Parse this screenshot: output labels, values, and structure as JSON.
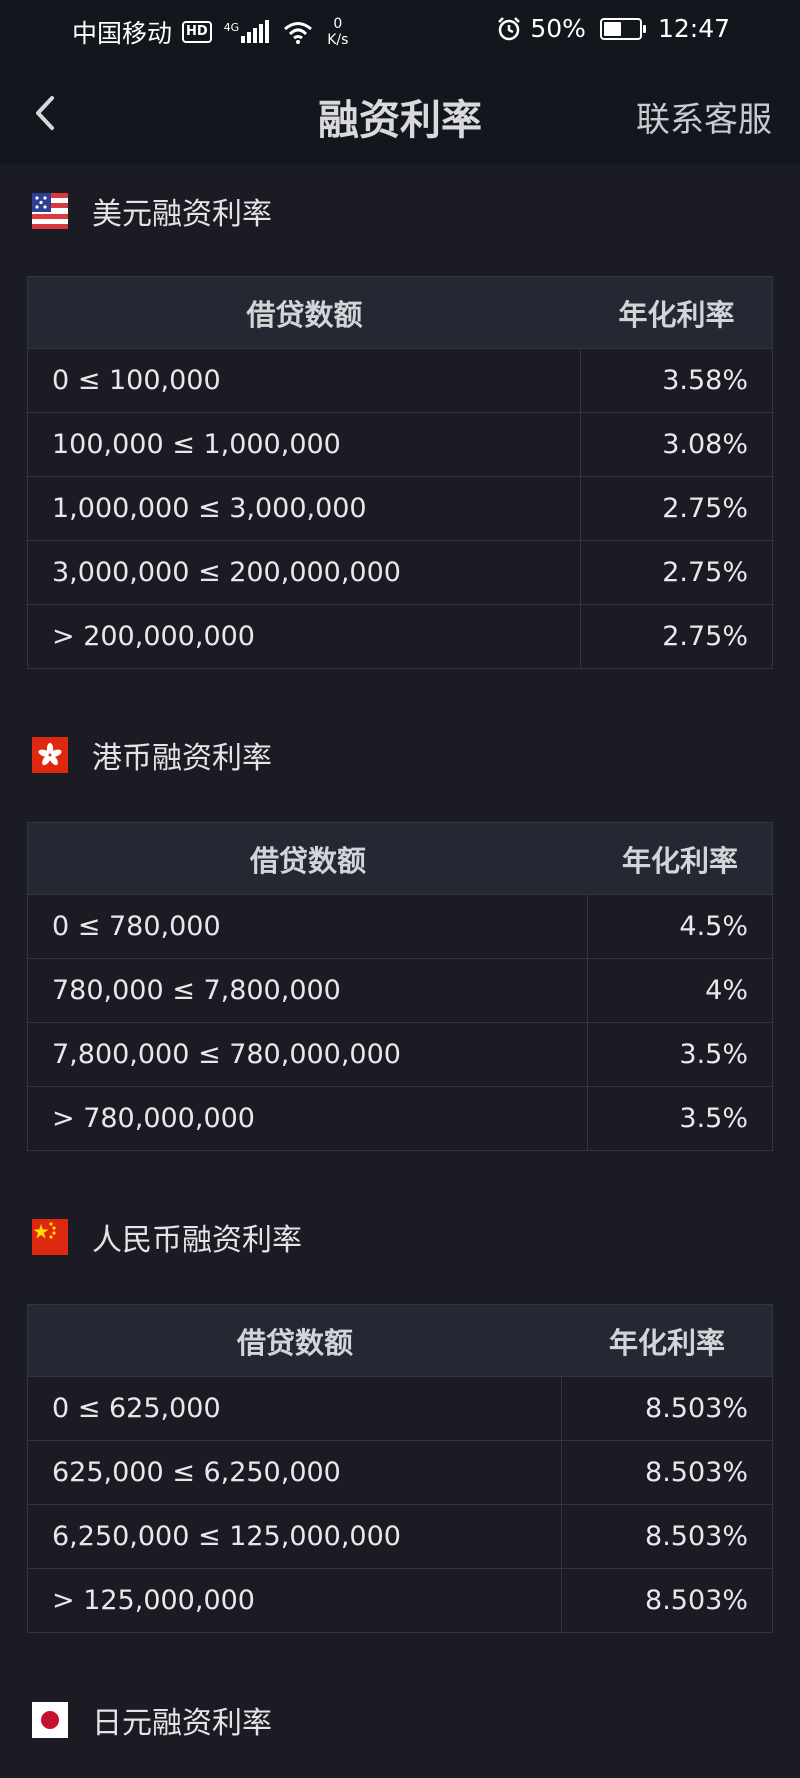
{
  "status_bar": {
    "carrier": "中国移动",
    "hd": "HD",
    "network": "4G",
    "speed_value": "0",
    "speed_unit": "K/s",
    "battery": "50%",
    "battery_level": 0.5,
    "time": "12:47"
  },
  "header": {
    "title": "融资利率",
    "action": "联系客服"
  },
  "sections": [
    {
      "title": "美元融资利率",
      "flag_icon": "us-flag-icon",
      "columns": [
        "借贷数额",
        "年化利率"
      ],
      "rows": [
        {
          "amount": "0 ≤ 100,000",
          "rate": "3.58%"
        },
        {
          "amount": "100,000 ≤ 1,000,000",
          "rate": "3.08%"
        },
        {
          "amount": "1,000,000 ≤ 3,000,000",
          "rate": "2.75%"
        },
        {
          "amount": "3,000,000 ≤ 200,000,000",
          "rate": "2.75%"
        },
        {
          "amount": "> 200,000,000",
          "rate": "2.75%"
        }
      ]
    },
    {
      "title": "港币融资利率",
      "flag_icon": "hk-flag-icon",
      "columns": [
        "借贷数额",
        "年化利率"
      ],
      "rows": [
        {
          "amount": "0 ≤ 780,000",
          "rate": "4.5%"
        },
        {
          "amount": "780,000 ≤ 7,800,000",
          "rate": "4%"
        },
        {
          "amount": "7,800,000 ≤ 780,000,000",
          "rate": "3.5%"
        },
        {
          "amount": "> 780,000,000",
          "rate": "3.5%"
        }
      ]
    },
    {
      "title": "人民币融资利率",
      "flag_icon": "cn-flag-icon",
      "columns": [
        "借贷数额",
        "年化利率"
      ],
      "rows": [
        {
          "amount": "0 ≤ 625,000",
          "rate": "8.503%"
        },
        {
          "amount": "625,000 ≤ 6,250,000",
          "rate": "8.503%"
        },
        {
          "amount": "6,250,000 ≤ 125,000,000",
          "rate": "8.503%"
        },
        {
          "amount": "> 125,000,000",
          "rate": "8.503%"
        }
      ]
    },
    {
      "title": "日元融资利率",
      "flag_icon": "jp-flag-icon"
    }
  ],
  "colors": {
    "background": "#1b1c23",
    "header_bg": "#12161d",
    "table_header_bg": "#232833",
    "border": "#32353f"
  }
}
